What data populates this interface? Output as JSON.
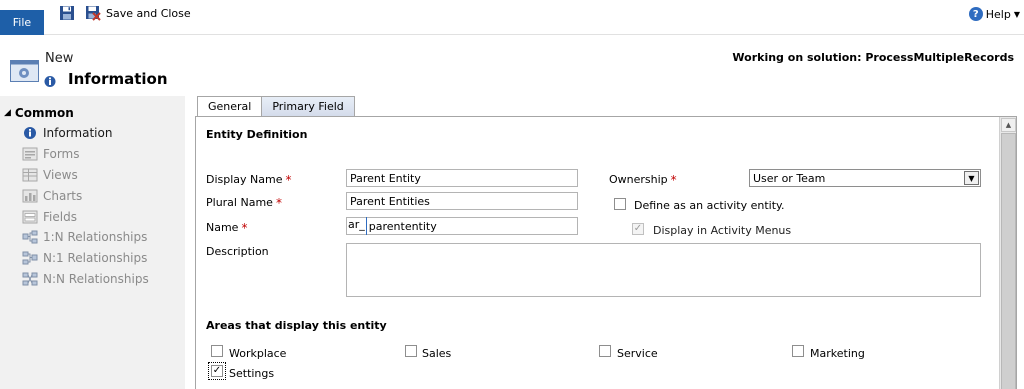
{
  "ribbon": {
    "file_label": "File",
    "save_close_label": "Save and Close",
    "help_label": "Help"
  },
  "header": {
    "subtitle": "New",
    "title": "Information",
    "solution": "Working on solution: ProcessMultipleRecords"
  },
  "nav": {
    "group": "Common",
    "items": [
      {
        "label": "Information",
        "icon": "info-icon",
        "active": true
      },
      {
        "label": "Forms",
        "icon": "forms-icon",
        "active": false
      },
      {
        "label": "Views",
        "icon": "views-icon",
        "active": false
      },
      {
        "label": "Charts",
        "icon": "charts-icon",
        "active": false
      },
      {
        "label": "Fields",
        "icon": "fields-icon",
        "active": false
      },
      {
        "label": "1:N Relationships",
        "icon": "relationship-icon",
        "active": false
      },
      {
        "label": "N:1 Relationships",
        "icon": "relationship-icon",
        "active": false
      },
      {
        "label": "N:N Relationships",
        "icon": "relationship-icon",
        "active": false
      }
    ]
  },
  "tabs": [
    "General",
    "Primary Field"
  ],
  "form": {
    "section_entity": "Entity Definition",
    "display_name_label": "Display Name",
    "display_name_value": "Parent Entity",
    "plural_name_label": "Plural Name",
    "plural_name_value": "Parent Entities",
    "name_label": "Name",
    "name_prefix": "ar_",
    "name_value": "parententity",
    "description_label": "Description",
    "ownership_label": "Ownership",
    "ownership_value": "User or Team",
    "define_activity_label": "Define as an activity entity.",
    "display_activity_menus_label": "Display in Activity Menus",
    "section_areas": "Areas that display this entity",
    "areas": [
      {
        "label": "Workplace",
        "checked": false
      },
      {
        "label": "Sales",
        "checked": false
      },
      {
        "label": "Service",
        "checked": false
      },
      {
        "label": "Marketing",
        "checked": false
      },
      {
        "label": "Settings",
        "checked": true
      }
    ]
  },
  "colors": {
    "file_button": "#1e5fa8",
    "required": "#c00000",
    "nav_bg": "#f1f1f1"
  }
}
